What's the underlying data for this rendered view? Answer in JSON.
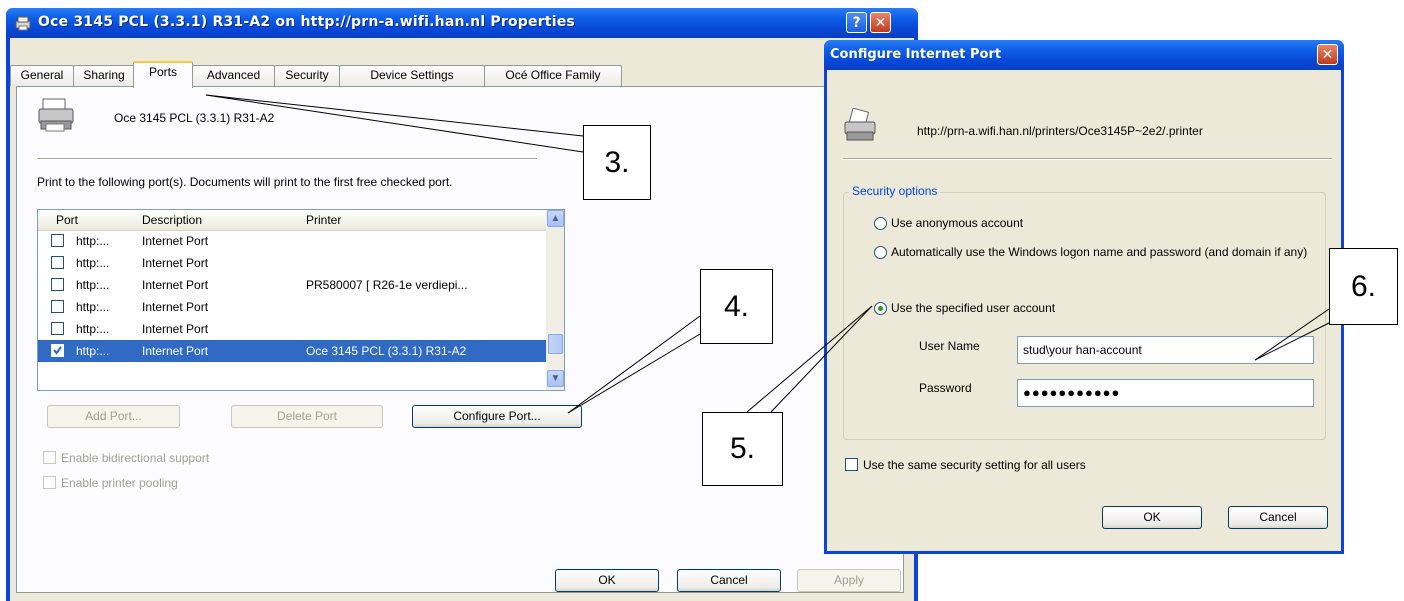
{
  "main_window": {
    "title": "Oce 3145 PCL (3.3.1) R31-A2 on http://prn-a.wifi.han.nl Properties",
    "help_label": "?",
    "close_label": "✕",
    "tabs": [
      {
        "label": "General"
      },
      {
        "label": "Sharing"
      },
      {
        "label": "Ports"
      },
      {
        "label": "Advanced"
      },
      {
        "label": "Security"
      },
      {
        "label": "Device Settings"
      },
      {
        "label": "Océ Office Family"
      }
    ],
    "active_tab": "Ports",
    "printer_name": "Oce 3145 PCL (3.3.1) R31-A2",
    "instructions": "Print to the following port(s). Documents will print to the first free checked port.",
    "columns": [
      "Port",
      "Description",
      "Printer"
    ],
    "ports": [
      {
        "port": "http:...",
        "description": "Internet Port",
        "printer": "",
        "checked": false
      },
      {
        "port": "http:...",
        "description": "Internet Port",
        "printer": "",
        "checked": false
      },
      {
        "port": "http:...",
        "description": "Internet Port",
        "printer": "PR580007 [ R26-1e verdiepi...",
        "checked": false
      },
      {
        "port": "http:...",
        "description": "Internet Port",
        "printer": "",
        "checked": false
      },
      {
        "port": "http:...",
        "description": "Internet Port",
        "printer": "",
        "checked": false
      },
      {
        "port": "http:...",
        "description": "Internet Port",
        "printer": "Oce 3145 PCL (3.3.1) R31-A2",
        "checked": true
      }
    ],
    "buttons": {
      "add_port": "Add Port...",
      "delete_port": "Delete Port",
      "configure_port": "Configure Port..."
    },
    "checkboxes": {
      "bidirectional": "Enable bidirectional support",
      "pooling": "Enable printer pooling"
    },
    "footer": {
      "ok": "OK",
      "cancel": "Cancel",
      "apply": "Apply"
    }
  },
  "configure_dialog": {
    "title": "Configure Internet Port",
    "close_label": "✕",
    "url": "http://prn-a.wifi.han.nl/printers/Oce3145P~2e2/.printer",
    "group_label": "Security options",
    "options": [
      {
        "label": "Use anonymous account",
        "selected": false
      },
      {
        "label": "Automatically use the Windows logon name and password (and domain if any)",
        "selected": false
      },
      {
        "label": "Use the specified user account",
        "selected": true
      }
    ],
    "user_name_label": "User Name",
    "user_name_value": "stud\\your han-account",
    "password_label": "Password",
    "password_value": "●●●●●●●●●●●",
    "same_setting_label": "Use the same security setting for all users",
    "ok": "OK",
    "cancel": "Cancel"
  },
  "callouts": {
    "c3": "3.",
    "c4": "4.",
    "c5": "5.",
    "c6": "6."
  }
}
